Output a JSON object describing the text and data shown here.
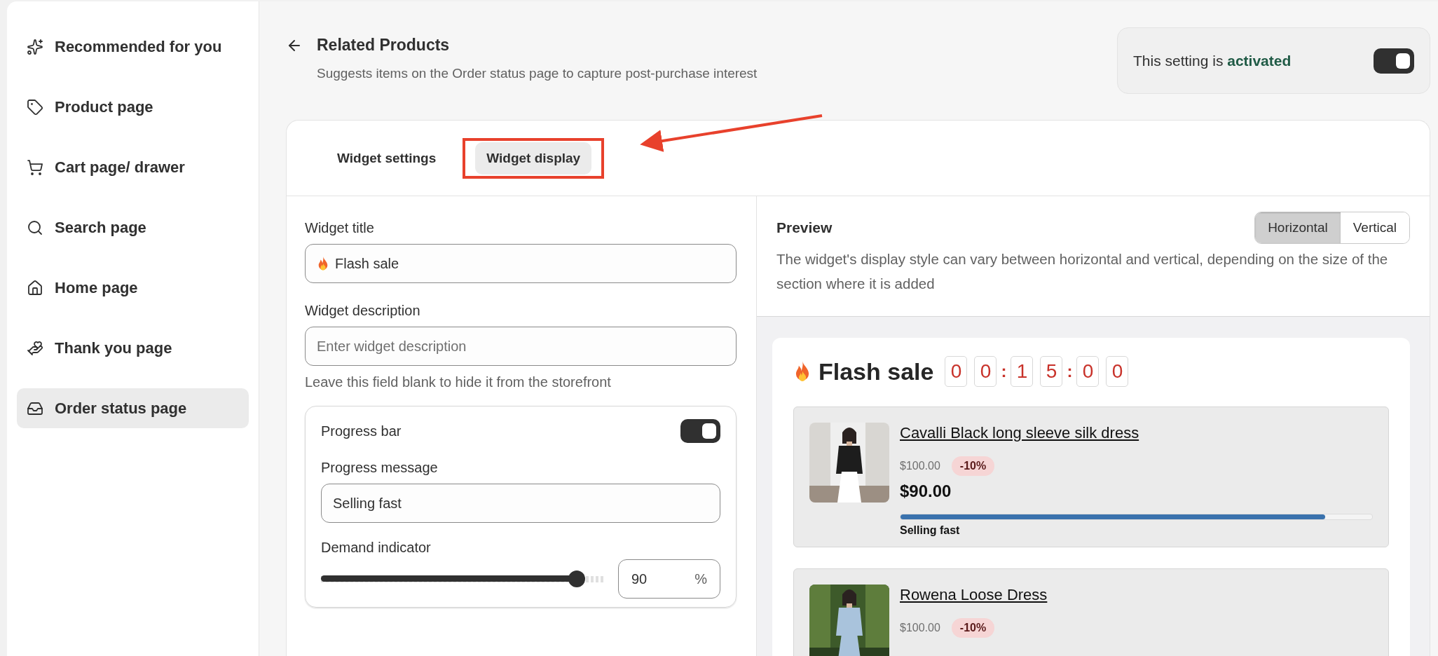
{
  "sidebar": {
    "items": [
      {
        "label": "Recommended for you",
        "selected": false
      },
      {
        "label": "Product page",
        "selected": false
      },
      {
        "label": "Cart page/ drawer",
        "selected": false
      },
      {
        "label": "Search page",
        "selected": false
      },
      {
        "label": "Home page",
        "selected": false
      },
      {
        "label": "Thank you page",
        "selected": false
      },
      {
        "label": "Order status page",
        "selected": true
      }
    ]
  },
  "header": {
    "title": "Related Products",
    "subtitle": "Suggests items on the Order status page to capture post-purchase interest",
    "status": {
      "text": "This setting is **activated**",
      "on": true
    }
  },
  "tabs": [
    {
      "label": "Widget settings",
      "selected": false,
      "highlighted": false
    },
    {
      "label": "Widget display",
      "selected": true,
      "highlighted": true
    }
  ],
  "form": {
    "title": {
      "label": "Widget title",
      "value": "Flash sale"
    },
    "description": {
      "label": "Widget description",
      "placeholder": "Enter widget description",
      "help": "Leave this field blank to hide it from the storefront"
    },
    "progress": {
      "label": "Progress bar",
      "on": true,
      "message_label": "Progress message",
      "message": "Selling fast",
      "demand_label": "Demand indicator",
      "level": 0.9,
      "value": "90",
      "unit": "%"
    }
  },
  "preview": {
    "title": "Preview",
    "options": [
      {
        "label": "Horizontal",
        "selected": true
      },
      {
        "label": "Vertical",
        "selected": false
      }
    ],
    "description": "The widget's display style can vary between horizontal and vertical, depending on the size of the section where it is added",
    "widget": {
      "title": "Flash sale",
      "timer": [
        {
          "kind": "digit",
          "text": "0"
        },
        {
          "kind": "digit",
          "text": "0"
        },
        {
          "kind": "separator",
          "text": ":"
        },
        {
          "kind": "digit",
          "text": "1"
        },
        {
          "kind": "digit",
          "text": "5"
        },
        {
          "kind": "separator",
          "text": ":"
        },
        {
          "kind": "digit",
          "text": "0"
        },
        {
          "kind": "digit",
          "text": "0"
        }
      ],
      "products": [
        {
          "name": "Cavalli Black long sleeve silk dress",
          "compare_price": "$100.00",
          "discount": "-10%",
          "price": "$90.00",
          "progress": {
            "level": 0.9,
            "label": "Selling fast"
          }
        },
        {
          "name": "Rowena Loose Dress",
          "compare_price": "$100.00",
          "discount": "-10%"
        }
      ]
    }
  }
}
